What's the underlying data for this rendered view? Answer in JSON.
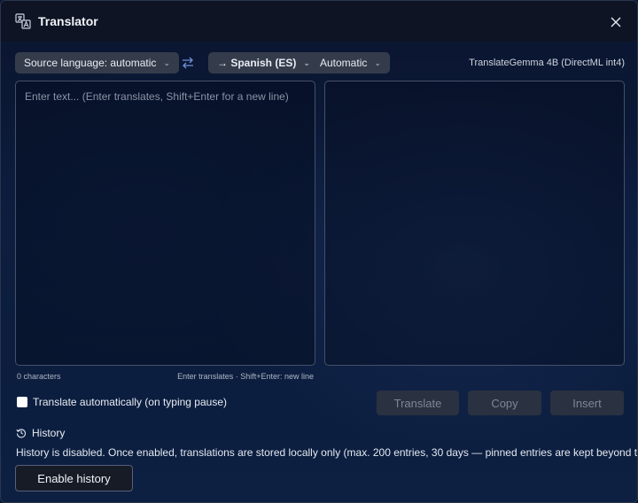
{
  "window": {
    "title": "Translator",
    "icon": "translate-icon",
    "close_icon": "close-icon"
  },
  "toolbar": {
    "source_language_label": "Source language: automatic",
    "swap_icon": "swap-arrows-icon",
    "target_language_label": "→ Spanish (ES)",
    "mode_label": "Automatic",
    "model_label": "TranslateGemma 4B (DirectML int4)"
  },
  "input": {
    "placeholder": "Enter text... (Enter translates, Shift+Enter for a new line)",
    "value": "",
    "char_count": "0 characters",
    "hint": "Enter translates · Shift+Enter: new line"
  },
  "output": {
    "value": ""
  },
  "options": {
    "auto_translate_label": "Translate automatically (on typing pause)",
    "auto_translate_checked": false
  },
  "actions": {
    "translate_label": "Translate",
    "copy_label": "Copy",
    "insert_label": "Insert"
  },
  "history": {
    "icon": "history-icon",
    "title": "History",
    "description": "History is disabled. Once enabled, translations are stored locally only (max. 200 entries, 30 days — pinned entries are kept beyond that).",
    "enable_label": "Enable history"
  },
  "colors": {
    "accent": "#343c4c",
    "disabled_button": "#2a3140"
  }
}
